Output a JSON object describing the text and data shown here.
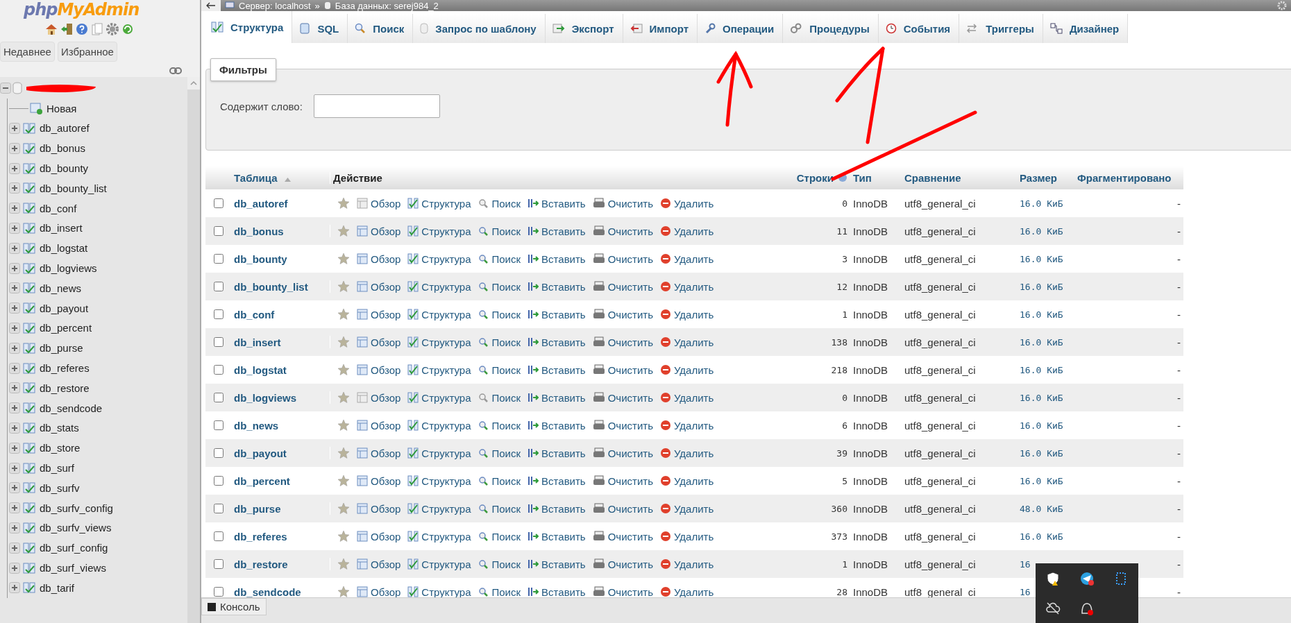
{
  "sidebar": {
    "logo": {
      "part1": "php",
      "part2": "MyAdmin"
    },
    "buttons": [
      "Недавнее",
      "Избранное"
    ],
    "tree": [
      {
        "expanded": true,
        "redacted": true,
        "children": [
          {
            "label": "Новая",
            "kind": "new"
          },
          {
            "label": "db_autoref",
            "kind": "table",
            "expanded": false
          },
          {
            "label": "db_bonus",
            "kind": "table",
            "expanded": false
          },
          {
            "label": "db_bounty",
            "kind": "table",
            "expanded": false
          },
          {
            "label": "db_bounty_list",
            "kind": "table",
            "expanded": false
          },
          {
            "label": "db_conf",
            "kind": "table",
            "expanded": false
          },
          {
            "label": "db_insert",
            "kind": "table",
            "expanded": false
          },
          {
            "label": "db_logstat",
            "kind": "table",
            "expanded": false
          },
          {
            "label": "db_logviews",
            "kind": "table",
            "expanded": false
          },
          {
            "label": "db_news",
            "kind": "table",
            "expanded": false
          },
          {
            "label": "db_payout",
            "kind": "table",
            "expanded": false
          },
          {
            "label": "db_percent",
            "kind": "table",
            "expanded": false
          },
          {
            "label": "db_purse",
            "kind": "table",
            "expanded": false
          },
          {
            "label": "db_referes",
            "kind": "table",
            "expanded": false
          },
          {
            "label": "db_restore",
            "kind": "table",
            "expanded": false
          },
          {
            "label": "db_sendcode",
            "kind": "table",
            "expanded": false
          },
          {
            "label": "db_stats",
            "kind": "table",
            "expanded": false
          },
          {
            "label": "db_store",
            "kind": "table",
            "expanded": false
          },
          {
            "label": "db_surf",
            "kind": "table",
            "expanded": false
          },
          {
            "label": "db_surfv",
            "kind": "table",
            "expanded": false
          },
          {
            "label": "db_surfv_config",
            "kind": "table",
            "expanded": false
          },
          {
            "label": "db_surfv_views",
            "kind": "table",
            "expanded": false
          },
          {
            "label": "db_surf_config",
            "kind": "table",
            "expanded": false
          },
          {
            "label": "db_surf_views",
            "kind": "table",
            "expanded": false
          },
          {
            "label": "db_tarif",
            "kind": "table",
            "expanded": false
          }
        ]
      }
    ]
  },
  "breadcrumb": [
    "Сервер: localhost",
    "»",
    "База данных: serej984_2"
  ],
  "tabs": [
    {
      "label": "Структура",
      "selected": true
    },
    {
      "label": "SQL",
      "selected": false
    },
    {
      "label": "Поиск",
      "selected": false
    },
    {
      "label": "Запрос по шаблону",
      "selected": false
    },
    {
      "label": "Экспорт",
      "selected": false
    },
    {
      "label": "Импорт",
      "selected": false
    },
    {
      "label": "Операции",
      "selected": false
    },
    {
      "label": "Процедуры",
      "selected": false
    },
    {
      "label": "События",
      "selected": false
    },
    {
      "label": "Триггеры",
      "selected": false
    },
    {
      "label": "Дизайнер",
      "selected": false
    }
  ],
  "filters": {
    "legend": "Фильтры",
    "label": "Содержит слово:"
  },
  "table": {
    "columns": [
      "Таблица",
      "Действие",
      "Строки",
      "Тип",
      "Сравнение",
      "Размер",
      "Фрагментировано"
    ],
    "rows": [
      {
        "name": "db_autoref",
        "checked": false,
        "empty": true,
        "actions": [
          "Обзор",
          "Структура",
          "Поиск",
          "Вставить",
          "Очистить",
          "Удалить"
        ],
        "rows": "0",
        "engine": "InnoDB",
        "collation": "utf8_general_ci",
        "size": "16.0 КиБ",
        "overhead": "-"
      },
      {
        "name": "db_bonus",
        "checked": false,
        "empty": false,
        "actions": [
          "Обзор",
          "Структура",
          "Поиск",
          "Вставить",
          "Очистить",
          "Удалить"
        ],
        "rows": "11",
        "engine": "InnoDB",
        "collation": "utf8_general_ci",
        "size": "16.0 КиБ",
        "overhead": "-"
      },
      {
        "name": "db_bounty",
        "checked": false,
        "empty": false,
        "actions": [
          "Обзор",
          "Структура",
          "Поиск",
          "Вставить",
          "Очистить",
          "Удалить"
        ],
        "rows": "3",
        "engine": "InnoDB",
        "collation": "utf8_general_ci",
        "size": "16.0 КиБ",
        "overhead": "-"
      },
      {
        "name": "db_bounty_list",
        "checked": false,
        "empty": false,
        "actions": [
          "Обзор",
          "Структура",
          "Поиск",
          "Вставить",
          "Очистить",
          "Удалить"
        ],
        "rows": "12",
        "engine": "InnoDB",
        "collation": "utf8_general_ci",
        "size": "16.0 КиБ",
        "overhead": "-"
      },
      {
        "name": "db_conf",
        "checked": false,
        "empty": false,
        "actions": [
          "Обзор",
          "Структура",
          "Поиск",
          "Вставить",
          "Очистить",
          "Удалить"
        ],
        "rows": "1",
        "engine": "InnoDB",
        "collation": "utf8_general_ci",
        "size": "16.0 КиБ",
        "overhead": "-"
      },
      {
        "name": "db_insert",
        "checked": false,
        "empty": false,
        "actions": [
          "Обзор",
          "Структура",
          "Поиск",
          "Вставить",
          "Очистить",
          "Удалить"
        ],
        "rows": "138",
        "engine": "InnoDB",
        "collation": "utf8_general_ci",
        "size": "16.0 КиБ",
        "overhead": "-"
      },
      {
        "name": "db_logstat",
        "checked": false,
        "empty": false,
        "actions": [
          "Обзор",
          "Структура",
          "Поиск",
          "Вставить",
          "Очистить",
          "Удалить"
        ],
        "rows": "218",
        "engine": "InnoDB",
        "collation": "utf8_general_ci",
        "size": "16.0 КиБ",
        "overhead": "-"
      },
      {
        "name": "db_logviews",
        "checked": false,
        "empty": true,
        "actions": [
          "Обзор",
          "Структура",
          "Поиск",
          "Вставить",
          "Очистить",
          "Удалить"
        ],
        "rows": "0",
        "engine": "InnoDB",
        "collation": "utf8_general_ci",
        "size": "16.0 КиБ",
        "overhead": "-"
      },
      {
        "name": "db_news",
        "checked": false,
        "empty": false,
        "actions": [
          "Обзор",
          "Структура",
          "Поиск",
          "Вставить",
          "Очистить",
          "Удалить"
        ],
        "rows": "6",
        "engine": "InnoDB",
        "collation": "utf8_general_ci",
        "size": "16.0 КиБ",
        "overhead": "-"
      },
      {
        "name": "db_payout",
        "checked": false,
        "empty": false,
        "actions": [
          "Обзор",
          "Структура",
          "Поиск",
          "Вставить",
          "Очистить",
          "Удалить"
        ],
        "rows": "39",
        "engine": "InnoDB",
        "collation": "utf8_general_ci",
        "size": "16.0 КиБ",
        "overhead": "-"
      },
      {
        "name": "db_percent",
        "checked": false,
        "empty": false,
        "actions": [
          "Обзор",
          "Структура",
          "Поиск",
          "Вставить",
          "Очистить",
          "Удалить"
        ],
        "rows": "5",
        "engine": "InnoDB",
        "collation": "utf8_general_ci",
        "size": "16.0 КиБ",
        "overhead": "-"
      },
      {
        "name": "db_purse",
        "checked": false,
        "empty": false,
        "actions": [
          "Обзор",
          "Структура",
          "Поиск",
          "Вставить",
          "Очистить",
          "Удалить"
        ],
        "rows": "360",
        "engine": "InnoDB",
        "collation": "utf8_general_ci",
        "size": "48.0 КиБ",
        "overhead": "-"
      },
      {
        "name": "db_referes",
        "checked": false,
        "empty": false,
        "actions": [
          "Обзор",
          "Структура",
          "Поиск",
          "Вставить",
          "Очистить",
          "Удалить"
        ],
        "rows": "373",
        "engine": "InnoDB",
        "collation": "utf8_general_ci",
        "size": "16.0 КиБ",
        "overhead": "-"
      },
      {
        "name": "db_restore",
        "checked": false,
        "empty": false,
        "actions": [
          "Обзор",
          "Структура",
          "Поиск",
          "Вставить",
          "Очистить",
          "Удалить"
        ],
        "rows": "1",
        "engine": "InnoDB",
        "collation": "utf8_general_ci",
        "size": "16",
        "overhead": "-"
      },
      {
        "name": "db_sendcode",
        "checked": false,
        "empty": false,
        "actions": [
          "Обзор",
          "Структура",
          "Поиск",
          "Вставить",
          "Очистить",
          "Удалить"
        ],
        "rows": "28",
        "engine": "InnoDB",
        "collation": "utf8_general_ci",
        "size": "16",
        "overhead": "-"
      }
    ]
  },
  "console": {
    "label": "Консоль"
  }
}
